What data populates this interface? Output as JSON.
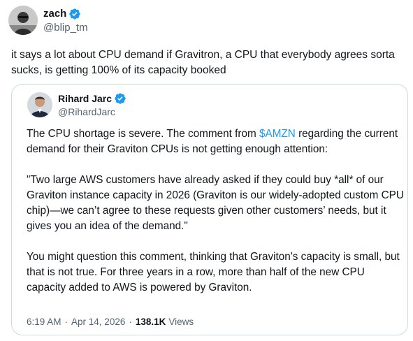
{
  "tweet": {
    "author": {
      "display_name": "zach",
      "handle": "@blip_tm",
      "verified": true,
      "avatar_icon": "avatar-photo-icon"
    },
    "text": "it says a lot about CPU demand if Gravitron, a CPU that everybody agrees sorta sucks, is getting 100% of its capacity booked"
  },
  "quoted_tweet": {
    "author": {
      "display_name": "Rihard Jarc",
      "handle": "@RihardJarc",
      "verified": true,
      "avatar_icon": "avatar-photo-icon"
    },
    "paragraph1": {
      "before": "The CPU shortage is severe. The comment from ",
      "cashtag": "$AMZN",
      "after": " regarding the current demand for their Graviton CPUs is not getting enough attention:"
    },
    "paragraph2": "\"Two large AWS customers have already asked if they could buy *all* of our Graviton instance capacity in 2026 (Graviton is our widely-adopted custom CPU chip)—we can’t agree to these requests given other customers’ needs, but it gives you an idea of the demand.\"",
    "paragraph3": "You might question this comment, thinking that Graviton's capacity is small, but that is not true. For three years in a row, more than half of the new CPU capacity added to AWS is powered by Graviton.",
    "time": "6:19 AM",
    "date": "Apr 14, 2026",
    "separator": "·",
    "views_count": "138.1K",
    "views_label": "Views"
  },
  "colors": {
    "accent": "#1d9bf0",
    "text": "#0f1419",
    "muted": "#536471",
    "border": "#cfd9de"
  }
}
